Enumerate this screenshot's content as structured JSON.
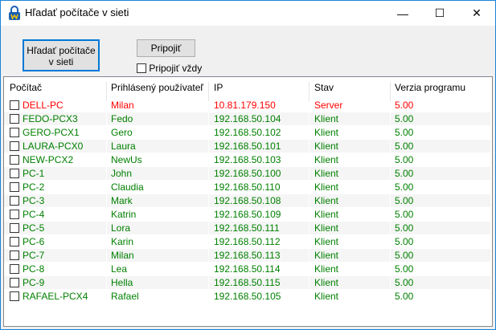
{
  "window": {
    "title": "Hľadať počítače v sieti",
    "minimize": "—",
    "maximize": "☐",
    "close": "✕"
  },
  "toolbar": {
    "search_label": "Hľadať počítače v sieti",
    "connect_label": "Pripojiť",
    "always_connect_label": "Pripojiť vždy",
    "always_connect_checked": false
  },
  "table": {
    "columns": [
      "Počítač",
      "Prihlásený používateľ",
      "IP",
      "Stav",
      "Verzia programu"
    ],
    "rows": [
      {
        "computer": "DELL-PC",
        "user": "Milan",
        "ip": "10.81.179.150",
        "status": "Server",
        "version": "5.00",
        "color": "#ff0000"
      },
      {
        "computer": "FEDO-PCX3",
        "user": "Fedo",
        "ip": "192.168.50.104",
        "status": "Klient",
        "version": "5.00",
        "color": "#008000"
      },
      {
        "computer": "GERO-PCX1",
        "user": "Gero",
        "ip": "192.168.50.102",
        "status": "Klient",
        "version": "5.00",
        "color": "#008000"
      },
      {
        "computer": "LAURA-PCX0",
        "user": "Laura",
        "ip": "192.168.50.101",
        "status": "Klient",
        "version": "5.00",
        "color": "#008000"
      },
      {
        "computer": "NEW-PCX2",
        "user": "NewUs",
        "ip": "192.168.50.103",
        "status": "Klient",
        "version": "5.00",
        "color": "#008000"
      },
      {
        "computer": "PC-1",
        "user": "John",
        "ip": "192.168.50.100",
        "status": "Klient",
        "version": "5.00",
        "color": "#008000"
      },
      {
        "computer": "PC-2",
        "user": "Claudia",
        "ip": "192.168.50.110",
        "status": "Klient",
        "version": "5.00",
        "color": "#008000"
      },
      {
        "computer": "PC-3",
        "user": "Mark",
        "ip": "192.168.50.108",
        "status": "Klient",
        "version": "5.00",
        "color": "#008000"
      },
      {
        "computer": "PC-4",
        "user": "Katrin",
        "ip": "192.168.50.109",
        "status": "Klient",
        "version": "5.00",
        "color": "#008000"
      },
      {
        "computer": "PC-5",
        "user": "Lora",
        "ip": "192.168.50.111",
        "status": "Klient",
        "version": "5.00",
        "color": "#008000"
      },
      {
        "computer": "PC-6",
        "user": "Karin",
        "ip": "192.168.50.112",
        "status": "Klient",
        "version": "5.00",
        "color": "#008000"
      },
      {
        "computer": "PC-7",
        "user": "Milan",
        "ip": "192.168.50.113",
        "status": "Klient",
        "version": "5.00",
        "color": "#008000"
      },
      {
        "computer": "PC-8",
        "user": "Lea",
        "ip": "192.168.50.114",
        "status": "Klient",
        "version": "5.00",
        "color": "#008000"
      },
      {
        "computer": "PC-9",
        "user": "Hella",
        "ip": "192.168.50.115",
        "status": "Klient",
        "version": "5.00",
        "color": "#008000"
      },
      {
        "computer": "RAFAEL-PCX4",
        "user": "Rafael",
        "ip": "192.168.50.105",
        "status": "Klient",
        "version": "5.00",
        "color": "#008000"
      }
    ]
  }
}
